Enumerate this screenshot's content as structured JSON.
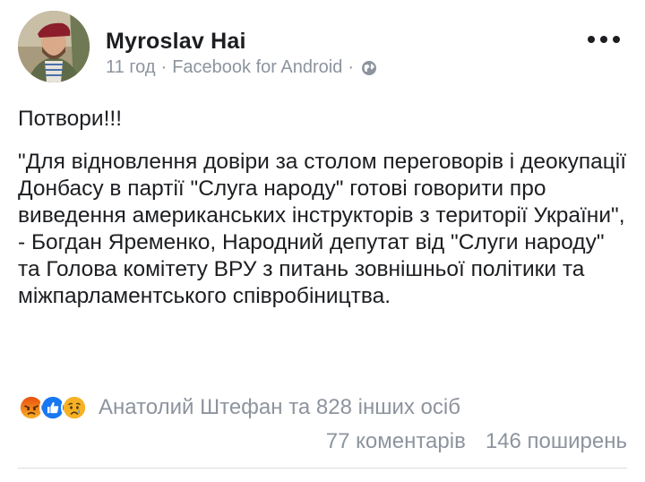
{
  "post": {
    "author": "Myroslav Hai",
    "time": "11 год",
    "separator": "·",
    "source": "Facebook for Android",
    "privacy_icon": "globe-icon",
    "menu_icon": "more-options-icon",
    "text_line1": "Потвори!!!",
    "text_quote": "\"Для відновлення довіри за столом переговорів і деокупації Донбасу в партії \"Слуга народу\" готові говорити про виведення американських інструкторів з території України\", - Богдан Яременко, Народний депутат від \"Слуги народу\" та Голова комітету ВРУ з питань зовнішньої політики та міжпарламентського співробіництва."
  },
  "reactions": {
    "icons": [
      "angry-icon",
      "like-icon",
      "sad-icon"
    ],
    "summary": "Анатолий Штефан та 828 інших осіб"
  },
  "stats": {
    "comments": "77 коментарів",
    "shares": "146 поширень"
  },
  "colors": {
    "text": "#1c1e21",
    "secondary": "#8d949e",
    "like_blue": "#1877f2",
    "angry_orange": "#e9710f",
    "sad_yellow": "#f7b125"
  }
}
